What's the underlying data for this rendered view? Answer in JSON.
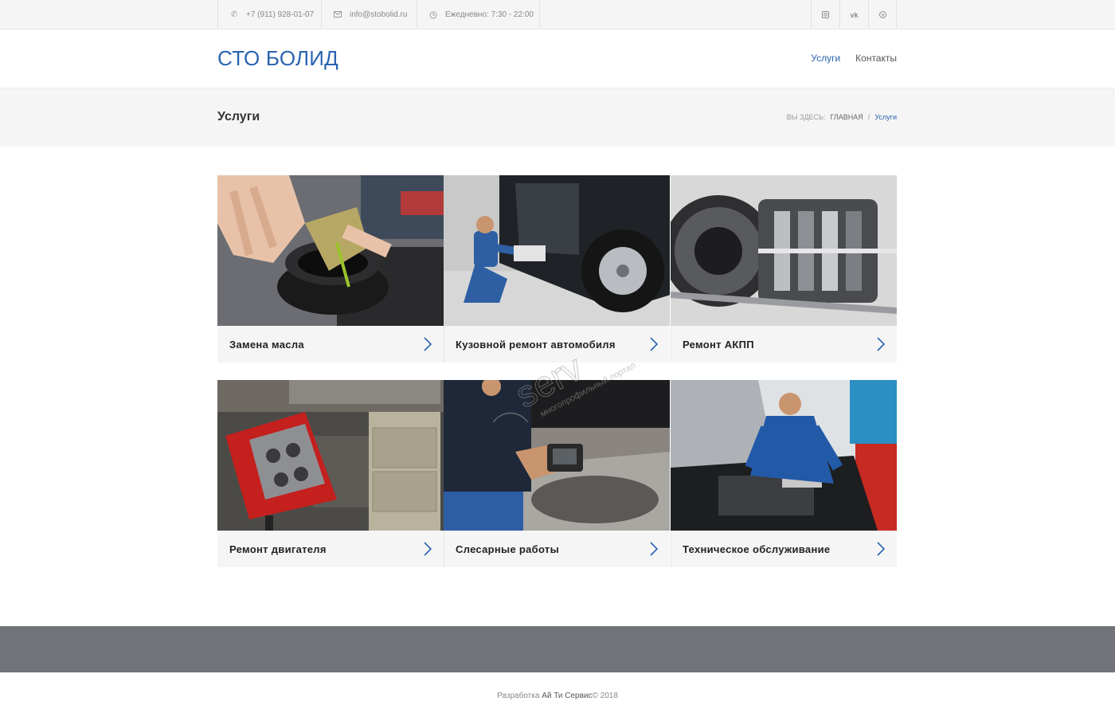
{
  "topbar": {
    "phone": "+7 (911) 928-01-07",
    "email": "info@stobolid.ru",
    "hours": "Ежедневно: 7:30 - 22:00",
    "social": [
      {
        "name": "instagram-icon"
      },
      {
        "name": "vk-icon"
      },
      {
        "name": "skype-icon"
      }
    ]
  },
  "header": {
    "logo": "СТО БОЛИД",
    "nav": [
      {
        "label": "Услуги",
        "active": true
      },
      {
        "label": "Контакты",
        "active": false
      }
    ]
  },
  "titlebar": {
    "title": "Услуги",
    "breadcrumb": {
      "prefix": "ВЫ ЗДЕСЬ:",
      "home": "ГЛАВНАЯ",
      "sep": "/",
      "current": "Услуги"
    }
  },
  "services": [
    {
      "label": "Замена масла"
    },
    {
      "label": "Кузовной ремонт автомобиля"
    },
    {
      "label": "Ремонт АКПП"
    },
    {
      "label": "Ремонт двигателя"
    },
    {
      "label": "Слесарные работы"
    },
    {
      "label": "Техническое обслуживание"
    }
  ],
  "footer": {
    "prefix": "Разработка",
    "brand": "Ай Ти Сервис",
    "suffix": "© 2018"
  },
  "colors": {
    "accent": "#2a63b2",
    "footer_band": "#707378",
    "panel": "#f5f5f5"
  }
}
